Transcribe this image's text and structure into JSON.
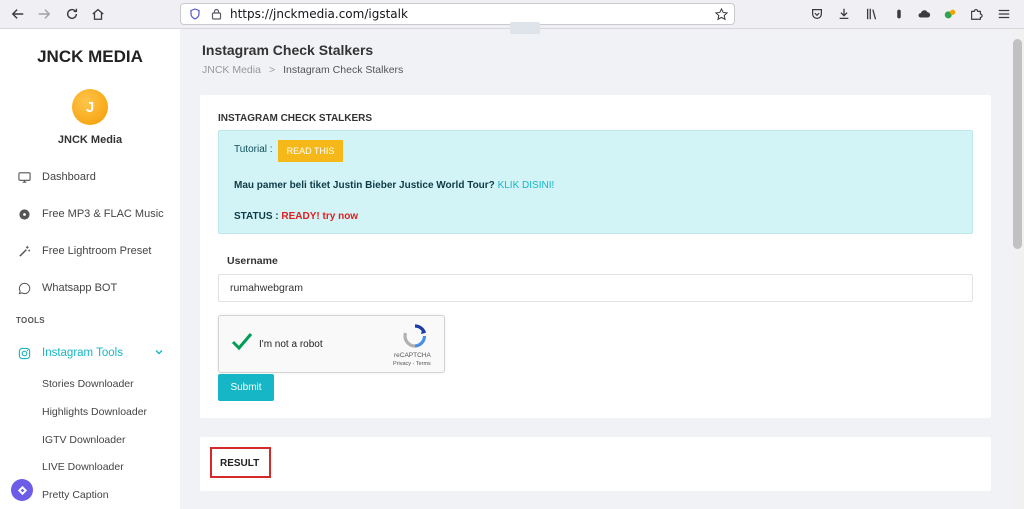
{
  "browser": {
    "url": "https://jnckmedia.com/igstalk",
    "icons": [
      "back-icon",
      "forward-icon",
      "reload-icon",
      "home-icon",
      "shield-icon",
      "lock-icon",
      "star-icon",
      "pocket-icon",
      "download-icon",
      "library-icon",
      "extension-icon",
      "puzzle-icon",
      "menu-icon"
    ]
  },
  "sidebar": {
    "brand": "JNCK MEDIA",
    "avatar_letter": "J",
    "user_name": "JNCK Media",
    "items": [
      {
        "label": "Dashboard",
        "icon": "monitor-icon"
      },
      {
        "label": "Free MP3 & FLAC Music",
        "icon": "disc-icon"
      },
      {
        "label": "Free Lightroom Preset",
        "icon": "magic-wand-icon"
      },
      {
        "label": "Whatsapp BOT",
        "icon": "whatsapp-icon"
      }
    ],
    "section_label": "TOOLS",
    "active_item": {
      "label": "Instagram Tools",
      "icon": "instagram-icon"
    },
    "sub_items": [
      {
        "label": "Stories Downloader"
      },
      {
        "label": "Highlights Downloader"
      },
      {
        "label": "IGTV Downloader"
      },
      {
        "label": "LIVE Downloader"
      },
      {
        "label": "Pretty Caption"
      }
    ]
  },
  "header": {
    "title": "Instagram Check Stalkers",
    "breadcrumb": [
      "JNCK Media",
      ">",
      "Instagram Check Stalkers"
    ]
  },
  "form_card": {
    "title": "INSTAGRAM CHECK STALKERS",
    "tutorial_label": "Tutorial :",
    "read_button": "READ THIS",
    "promo_text": "Mau pamer beli tiket Justin Bieber Justice World Tour?",
    "promo_link": "KLIK DISINI!",
    "status_label": "STATUS :",
    "status_value": "READY! try now",
    "username_label": "Username",
    "username_value": "rumahwebgram",
    "captcha_text": "I'm not a robot",
    "captcha_brand": "reCAPTCHA",
    "captcha_links": "Privacy - Terms",
    "submit_label": "Submit"
  },
  "result_card": {
    "label": "RESULT"
  },
  "colors": {
    "accent": "#17b6c7",
    "button_yellow": "#f6b818",
    "status_red": "#e01e1e",
    "info_bg": "#d2f4f7",
    "highlight_red": "#d62a2a"
  }
}
